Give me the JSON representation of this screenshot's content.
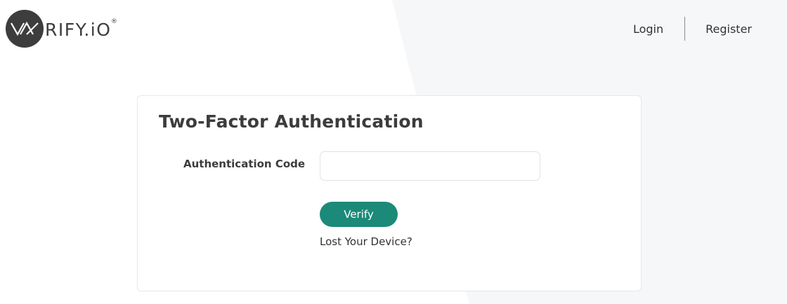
{
  "header": {
    "logo": {
      "text": "RIFY.iO",
      "registered_mark": "®"
    },
    "nav": {
      "login_label": "Login",
      "register_label": "Register"
    }
  },
  "card": {
    "title": "Two-Factor Authentication",
    "field_label": "Authentication Code",
    "code_value": "",
    "code_placeholder": "",
    "verify_label": "Verify",
    "lost_device_label": "Lost Your Device?"
  },
  "colors": {
    "accent": "#1b8a78",
    "logo": "#3d3d3d",
    "background_panel": "#f5f7f9"
  }
}
